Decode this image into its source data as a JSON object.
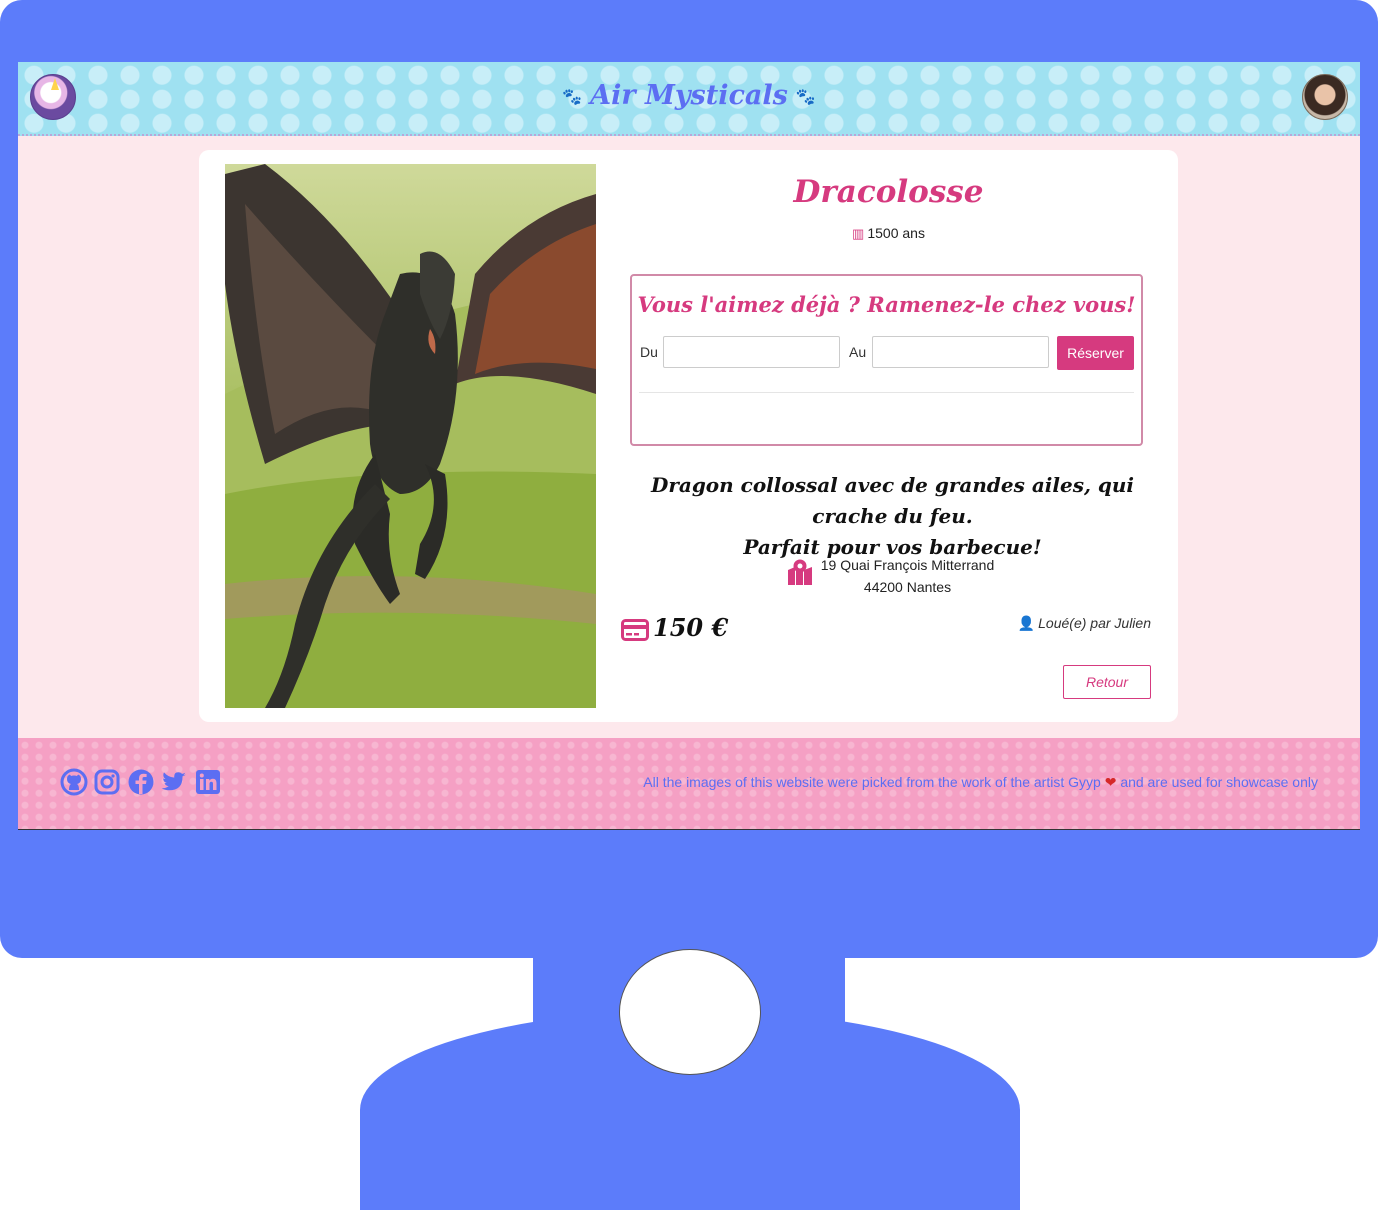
{
  "header": {
    "brand": "Air Mysticals",
    "brand_icons": [
      "paw-icon",
      "paw-icon"
    ]
  },
  "creature": {
    "name": "Dracolosse",
    "age": "1500 ans",
    "description_line1": "Dragon collossal avec de grandes ailes, qui crache du feu.",
    "description_line2": "Parfait pour vos barbecue!",
    "address_line1": "19 Quai François Mitterrand",
    "address_line2": "44200 Nantes",
    "price": "150 €",
    "rented_by": "Loué(e) par Julien"
  },
  "booking": {
    "title": "Vous l'aimez déjà ? Ramenez-le chez vous!",
    "from_label": "Du",
    "to_label": "Au",
    "from_value": "",
    "to_value": "",
    "reserve_label": "Réserver"
  },
  "actions": {
    "back_label": "Retour"
  },
  "footer": {
    "social_icons": [
      "github-icon",
      "instagram-icon",
      "facebook-icon",
      "twitter-icon",
      "linkedin-icon"
    ],
    "credit_before": "All the images of this website were picked from the work of the artist Gyyp",
    "credit_after": "and are used for showcase only"
  },
  "colors": {
    "monitor": "#5c7cfa",
    "header": "#9fe1f1",
    "accent": "#d63a7f",
    "page_bg": "#fde8ec",
    "footer": "#f5a0c4",
    "footer_text": "#5c6ef2"
  }
}
